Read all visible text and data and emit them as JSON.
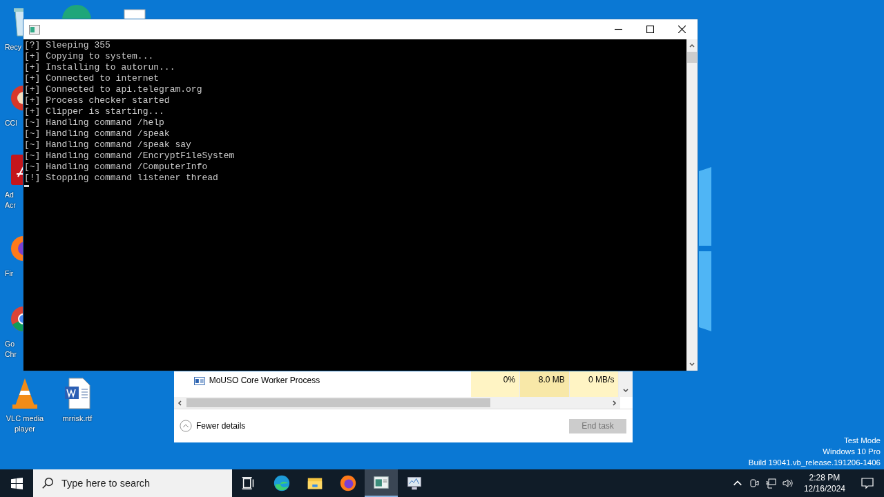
{
  "desktop": {
    "icons": [
      {
        "kind": "recycle",
        "lines": [
          "Recy"
        ]
      },
      {
        "kind": "ccleaner",
        "lines": [
          "CCl"
        ]
      },
      {
        "kind": "acrobat",
        "lines": [
          "Ad",
          "Acr"
        ]
      },
      {
        "kind": "firefox",
        "lines": [
          "Fir"
        ]
      },
      {
        "kind": "chrome",
        "lines": [
          "Go",
          "Chr"
        ]
      },
      {
        "kind": "vlc",
        "lines": [
          "VLC media",
          "player"
        ]
      },
      {
        "kind": "word",
        "lines": [
          "mrrisk.rtf"
        ]
      }
    ],
    "os_info": [
      "Test Mode",
      "Windows 10 Pro",
      "Build 19041.vb_release.191206-1406"
    ]
  },
  "task_manager": {
    "rows": [
      {
        "name": "MoUSO Core Worker Process",
        "cpu": "0%",
        "memory": "8.0 MB",
        "disk": "0 MB/s"
      }
    ],
    "toggle": "Fewer details",
    "end_task": {
      "label": "End task",
      "disabled": true
    }
  },
  "console": {
    "lines": [
      "[?] Sleeping 355",
      "[+] Copying to system...",
      "[+] Installing to autorun...",
      "[+] Connected to internet",
      "[+] Connected to api.telegram.org",
      "[+] Process checker started",
      "[+] Clipper is starting...",
      "[~] Handling command /help",
      "[~] Handling command /speak",
      "[~] Handling command /speak say",
      "[~] Handling command /EncryptFileSystem",
      "[~] Handling command /ComputerInfo",
      "[!] Stopping command listener thread"
    ]
  },
  "taskbar": {
    "search": {
      "placeholder": "Type here to search"
    },
    "apps": [
      {
        "kind": "taskview",
        "selected": false
      },
      {
        "kind": "edge",
        "selected": false
      },
      {
        "kind": "folder",
        "selected": false
      },
      {
        "kind": "firefox",
        "selected": false
      },
      {
        "kind": "console",
        "selected": true
      },
      {
        "kind": "monitor",
        "selected": false
      }
    ],
    "clock": {
      "time": "2:28 PM",
      "date": "12/16/2024"
    }
  }
}
